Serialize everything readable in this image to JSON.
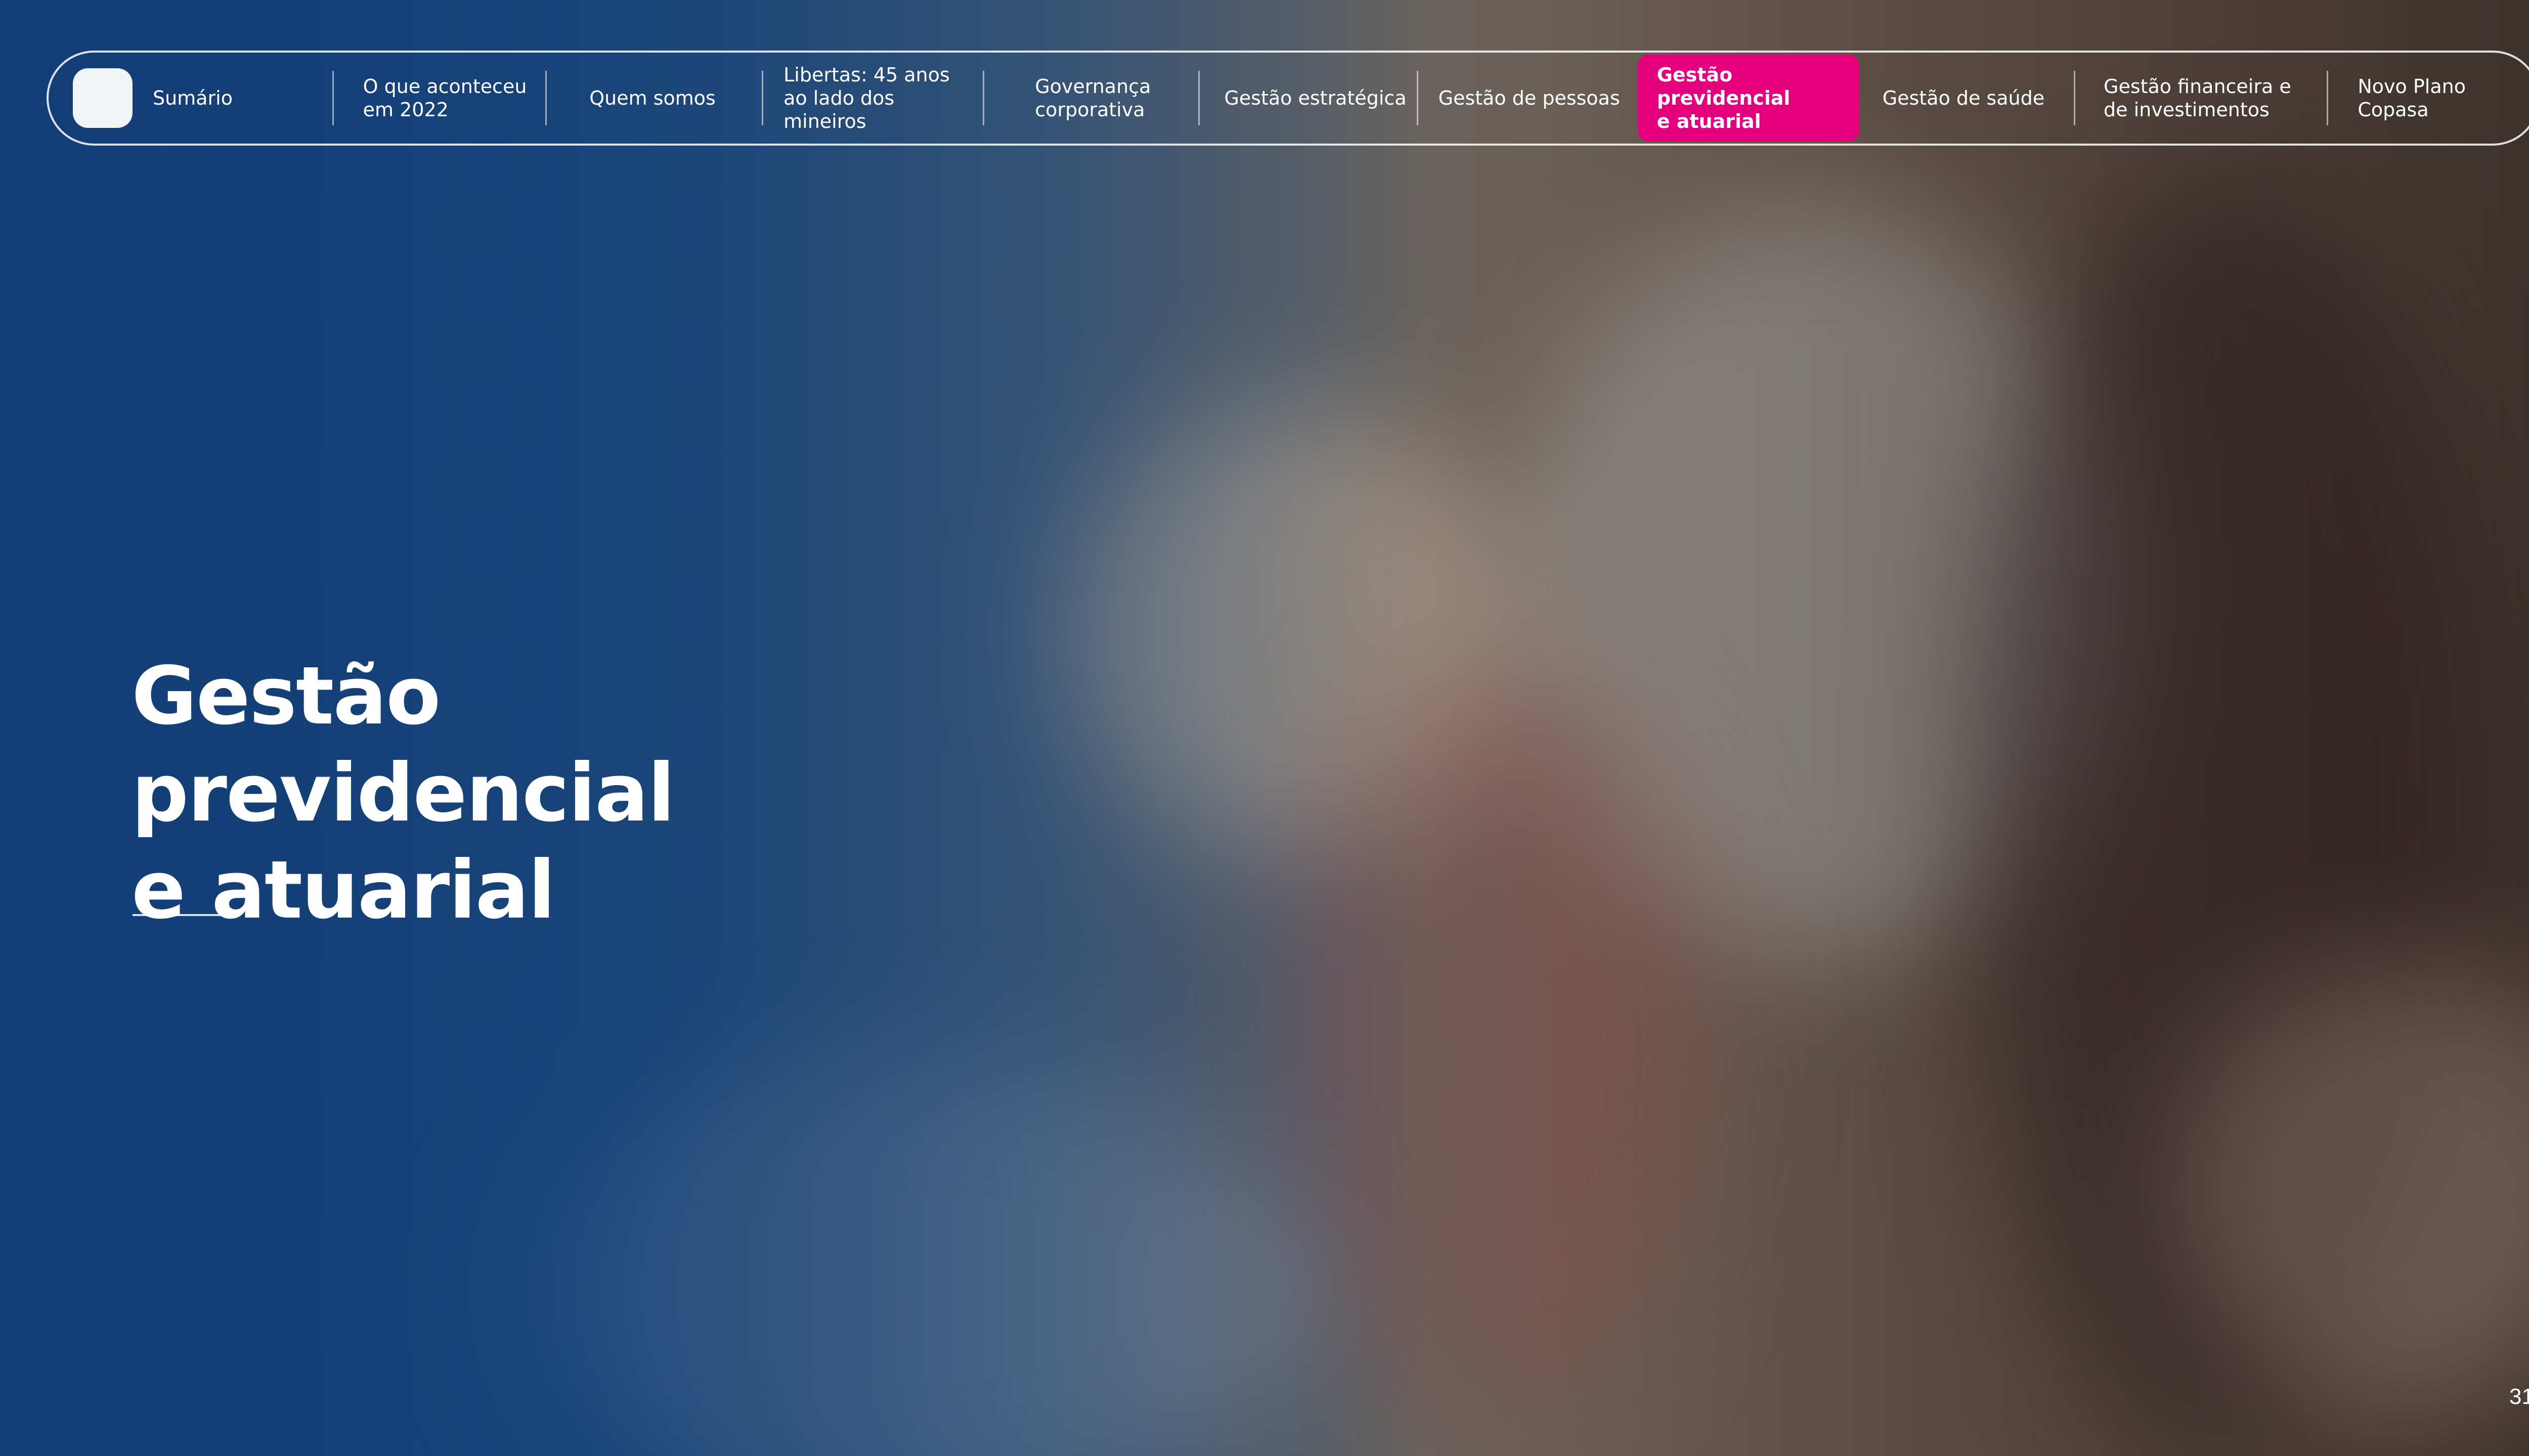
{
  "nav": {
    "home_icon": "home-square-icon",
    "items": [
      {
        "label": "Sumário"
      },
      {
        "label": "O que aconteceu\nem 2022"
      },
      {
        "label": "Quem somos"
      },
      {
        "label": "Libertas: 45 anos\nao lado dos mineiros"
      },
      {
        "label": "Governança\ncorporativa"
      },
      {
        "label": "Gestão estratégica"
      },
      {
        "label": "Gestão de pessoas"
      },
      {
        "label": "Gestão previdencial\ne atuarial",
        "active": true
      },
      {
        "label": "Gestão de saúde"
      },
      {
        "label": "Gestão financeira e\nde investimentos"
      },
      {
        "label": "Novo Plano Copasa"
      }
    ]
  },
  "main": {
    "title": "Gestão\nprevidencial\ne atuarial"
  },
  "footer": {
    "page_number": "31"
  },
  "colors": {
    "accent": "#e6007e",
    "overlay_blue": "#123e78",
    "text": "#ffffff"
  }
}
